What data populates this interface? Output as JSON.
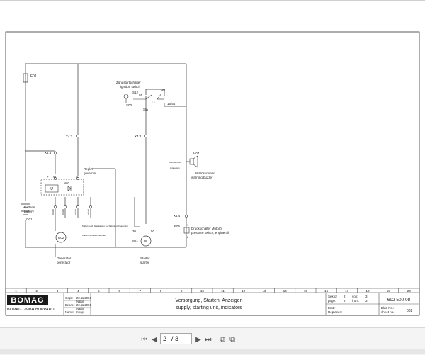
{
  "schematic": {
    "labels": {
      "f01": "F01",
      "ignition_de": "Zündstartschalter",
      "ignition_en": "ignition switch",
      "s12": "S12",
      "r01": "01",
      "s00": "S00",
      "sta": "Sta",
      "r30": "30",
      "r1554": "15/54",
      "x41": "X4:1",
      "x43": "X4:3",
      "h07": "H07",
      "horn_note_1": "Warnsummer",
      "horn_note_2": "Ansaugen",
      "horn_de": "Warnsummer",
      "horn_en": "warning buzzer",
      "x46": "X4:6",
      "regulator_de": "Regler",
      "regulator_en": "governor",
      "plus": "+",
      "w": "W",
      "b": "B",
      "n01": "N01",
      "u": "U",
      "battery_de": "Batterie",
      "battery_en": "battery",
      "g01": "G01",
      "wire_1": "rot/wt",
      "wire_2": "rot/wt",
      "wire_3": "rot/wt",
      "wire_4": "rot/wt",
      "note_1": "Kabel durch Glaskasten zur Kabeldurchfuehrung",
      "note_2": "Kabel mit Kabel-Taschen",
      "g02": "G02",
      "m01": "M01",
      "r30b": "30",
      "r50": "50",
      "motor_m": "M",
      "starter_de": "Starter",
      "starter_en": "starter",
      "generator_de": "Generator",
      "generator_en": "generator",
      "x44": "X4:4",
      "b06": "B06",
      "pressure_de": "Druckschalter Motoröl",
      "pressure_en": "pressure switch, engine oil",
      "p1": "1",
      "p2": "2"
    },
    "columns": [
      "1",
      "2",
      "3",
      "4",
      "5",
      "6",
      "7",
      "8",
      "9",
      "10",
      "11",
      "12",
      "13",
      "14",
      "15",
      "16",
      "17",
      "18",
      "19",
      "20"
    ]
  },
  "title_block": {
    "logo": "BOMAG",
    "company": "BOMAG GMBH BOPPARD",
    "rows": [
      {
        "label": "Gepr.:",
        "date": "20.11.2001",
        "name": "Naßin"
      },
      {
        "label": "Bearb.:",
        "date": "22.11.2001",
        "name": "Naßin"
      },
      {
        "label": "Name:",
        "date": "",
        "name": "Knop"
      }
    ],
    "title_de": "Versorgung, Starten, Anzeigen",
    "title_en": "supply, starting unit, indicators",
    "sector_label": "Sektor",
    "sector_value": "2",
    "page_label": "page:",
    "page_value": "2",
    "von_label": "von:",
    "von_value": "3",
    "from_label": "from:",
    "from_value": "3",
    "erst_label": "Erst.:",
    "replaces_label": "Replaces:",
    "drawing_no": "692 500 08",
    "blatt_label": "Blatt No.:",
    "sheet_label": "sheet no.:",
    "sheet_value": "002"
  },
  "viewer": {
    "page_current": "2",
    "page_total": "/ 3"
  }
}
